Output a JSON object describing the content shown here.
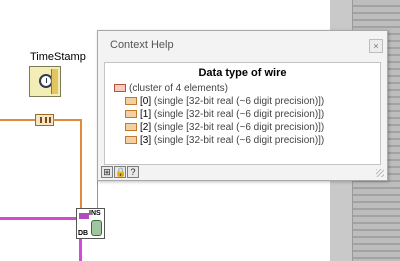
{
  "diagram": {
    "timestamp_label": "TimeStamp",
    "subvi_top_label": "INS",
    "subvi_bottom_label": "DB",
    "icons": [
      "clock-icon",
      "unbundle-icon",
      "database-icon"
    ]
  },
  "context_help": {
    "title": "Context Help",
    "heading": "Data type of wire",
    "cluster_line": "(cluster of 4 elements)",
    "elements": [
      {
        "index": "[0]",
        "type": "(single [32-bit real (~6 digit precision)])"
      },
      {
        "index": "[1]",
        "type": "(single [32-bit real (~6 digit precision)])"
      },
      {
        "index": "[2]",
        "type": "(single [32-bit real (~6 digit precision)])"
      },
      {
        "index": "[3]",
        "type": "(single [32-bit real (~6 digit precision)])"
      }
    ],
    "bottom_buttons": [
      "connector-icon",
      "lock-icon",
      "help-icon"
    ]
  },
  "colors": {
    "orange_wire": "#e08a3c",
    "pink_wire": "#d44ad7",
    "timestamp_bg": "#f3eeb6"
  }
}
